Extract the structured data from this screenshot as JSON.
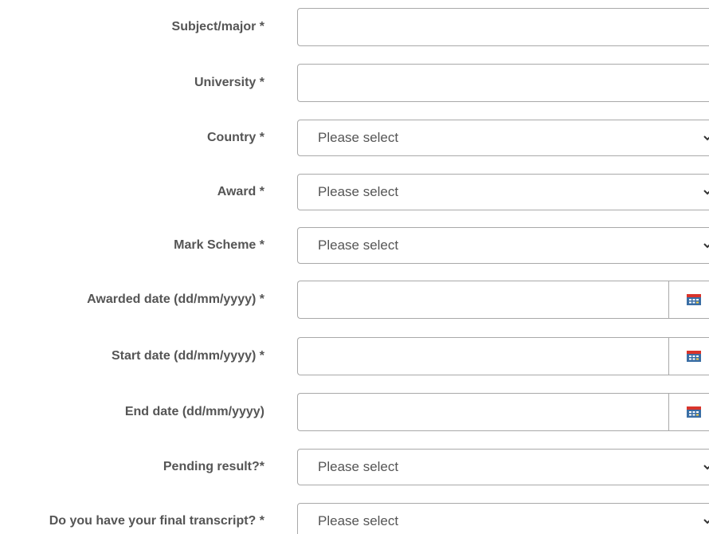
{
  "form": {
    "subject": {
      "label": "Subject/major *",
      "value": ""
    },
    "university": {
      "label": "University *",
      "value": ""
    },
    "country": {
      "label": "Country *",
      "selected": "Please select"
    },
    "award": {
      "label": "Award *",
      "selected": "Please select"
    },
    "mark_scheme": {
      "label": "Mark Scheme *",
      "selected": "Please select"
    },
    "awarded_date": {
      "label": "Awarded date (dd/mm/yyyy) *",
      "value": ""
    },
    "start_date": {
      "label": "Start date (dd/mm/yyyy) *",
      "value": ""
    },
    "end_date": {
      "label": "End date (dd/mm/yyyy)",
      "value": ""
    },
    "pending_result": {
      "label": "Pending result?*",
      "selected": "Please select"
    },
    "final_transcript": {
      "label": "Do you have your final transcript? *",
      "selected": "Please select"
    }
  },
  "icons": {
    "dropdown": "chevron-down-icon",
    "date_picker": "calendar-icon"
  },
  "colors": {
    "label_text": "#555555",
    "border": "#a9a9a9",
    "calendar_blue": "#3a6ea5",
    "calendar_red": "#d9342b"
  }
}
